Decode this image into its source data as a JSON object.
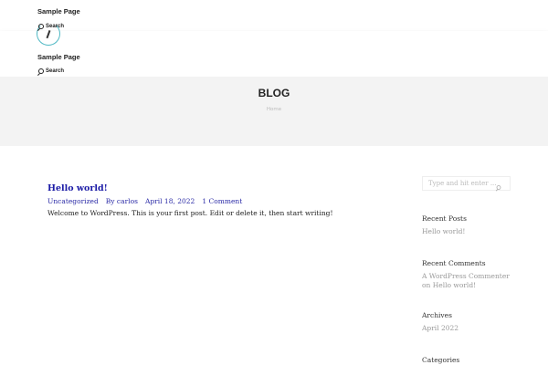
{
  "header": {
    "nav_label": "Sample Page",
    "search_label": "Search"
  },
  "mobile_header": {
    "nav_label": "Sample Page",
    "search_label": "Search"
  },
  "page_title": "BLOG",
  "breadcrumb": "Home",
  "post": {
    "title": "Hello world!",
    "category": "Uncategorized",
    "author": "By carlos",
    "date": "April 18, 2022",
    "comments": "1 Comment",
    "excerpt": "Welcome to WordPress. This is your first post. Edit or delete it, then start writing!"
  },
  "sidebar": {
    "search_placeholder": "Type and hit enter ...",
    "recent_posts": {
      "title": "Recent Posts",
      "items": [
        "Hello world!"
      ]
    },
    "recent_comments": {
      "title": "Recent Comments",
      "line1": "A WordPress Commenter",
      "line2": "on Hello world!"
    },
    "archives": {
      "title": "Archives",
      "items": [
        "April 2022"
      ]
    },
    "categories": {
      "title": "Categories"
    }
  }
}
